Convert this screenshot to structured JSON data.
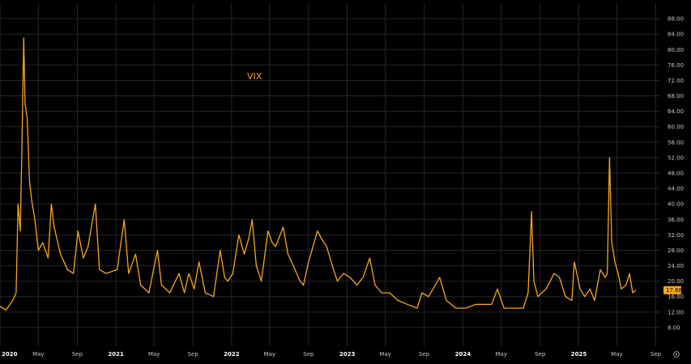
{
  "chart_data": {
    "type": "line",
    "series_label": "VIX",
    "last_value_label": "17.68",
    "settings_icon": "settings-gear-icon",
    "line_color": "#f5a623",
    "background_color": "#000000",
    "grid": true,
    "y_axis_position": "right",
    "ylim": [
      4,
      92
    ],
    "y_ticks": [
      "8.00",
      "12.00",
      "16.00",
      "20.00",
      "24.00",
      "28.00",
      "32.00",
      "36.00",
      "40.00",
      "44.00",
      "48.00",
      "52.00",
      "56.00",
      "60.00",
      "64.00",
      "68.00",
      "72.00",
      "76.00",
      "80.00",
      "84.00",
      "88.00"
    ],
    "xlim": [
      "2020-01-01",
      "2025-09-15"
    ],
    "x_ticks": [
      {
        "date": "2020-01-01",
        "label": "2020",
        "year": true
      },
      {
        "date": "2020-05-01",
        "label": "May"
      },
      {
        "date": "2020-09-01",
        "label": "Sep"
      },
      {
        "date": "2021-01-01",
        "label": "2021",
        "year": true
      },
      {
        "date": "2021-05-01",
        "label": "May"
      },
      {
        "date": "2021-09-01",
        "label": "Sep"
      },
      {
        "date": "2022-01-01",
        "label": "2022",
        "year": true
      },
      {
        "date": "2022-05-01",
        "label": "May"
      },
      {
        "date": "2022-09-01",
        "label": "Sep"
      },
      {
        "date": "2023-01-01",
        "label": "2023",
        "year": true
      },
      {
        "date": "2023-05-01",
        "label": "May"
      },
      {
        "date": "2023-09-01",
        "label": "Sep"
      },
      {
        "date": "2024-01-01",
        "label": "2024",
        "year": true
      },
      {
        "date": "2024-05-01",
        "label": "May"
      },
      {
        "date": "2024-09-01",
        "label": "Sep"
      },
      {
        "date": "2025-01-01",
        "label": "2025",
        "year": true
      },
      {
        "date": "2025-05-01",
        "label": "May"
      },
      {
        "date": "2025-09-01",
        "label": "Sep"
      }
    ],
    "series": [
      {
        "x": [
          "2020-01-01",
          "2020-01-20",
          "2020-02-10",
          "2020-02-21",
          "2020-02-27",
          "2020-03-05",
          "2020-03-10",
          "2020-03-16",
          "2020-03-20",
          "2020-03-27",
          "2020-04-03",
          "2020-04-10",
          "2020-04-20",
          "2020-05-01",
          "2020-05-15",
          "2020-06-01",
          "2020-06-11",
          "2020-06-20",
          "2020-07-10",
          "2020-08-01",
          "2020-08-20",
          "2020-09-03",
          "2020-09-20",
          "2020-10-05",
          "2020-10-28",
          "2020-11-10",
          "2020-12-01",
          "2021-01-05",
          "2021-01-27",
          "2021-02-10",
          "2021-03-04",
          "2021-03-20",
          "2021-04-15",
          "2021-05-12",
          "2021-05-25",
          "2021-06-20",
          "2021-07-19",
          "2021-08-05",
          "2021-08-19",
          "2021-09-05",
          "2021-09-20",
          "2021-10-10",
          "2021-11-05",
          "2021-11-26",
          "2021-12-10",
          "2021-12-20",
          "2022-01-05",
          "2022-01-24",
          "2022-02-10",
          "2022-02-24",
          "2022-03-07",
          "2022-03-20",
          "2022-04-05",
          "2022-04-26",
          "2022-05-09",
          "2022-05-20",
          "2022-06-13",
          "2022-06-28",
          "2022-07-15",
          "2022-08-05",
          "2022-08-16",
          "2022-09-01",
          "2022-09-29",
          "2022-10-12",
          "2022-10-28",
          "2022-11-15",
          "2022-12-01",
          "2022-12-20",
          "2023-01-10",
          "2023-02-01",
          "2023-02-20",
          "2023-03-13",
          "2023-03-30",
          "2023-04-20",
          "2023-05-15",
          "2023-06-10",
          "2023-07-10",
          "2023-08-10",
          "2023-08-25",
          "2023-09-15",
          "2023-10-20",
          "2023-11-10",
          "2023-12-10",
          "2024-01-10",
          "2024-02-10",
          "2024-03-10",
          "2024-04-01",
          "2024-04-19",
          "2024-05-10",
          "2024-06-10",
          "2024-07-10",
          "2024-07-25",
          "2024-08-05",
          "2024-08-12",
          "2024-08-25",
          "2024-09-06",
          "2024-09-20",
          "2024-10-15",
          "2024-11-01",
          "2024-11-20",
          "2024-12-10",
          "2024-12-18",
          "2025-01-05",
          "2025-01-20",
          "2025-02-05",
          "2025-02-20",
          "2025-03-10",
          "2025-03-25",
          "2025-04-01",
          "2025-04-08",
          "2025-04-15",
          "2025-04-25",
          "2025-05-05",
          "2025-05-15",
          "2025-05-30",
          "2025-06-10",
          "2025-06-20",
          "2025-06-30"
        ],
        "values": [
          13.5,
          12.5,
          15,
          17,
          40,
          33,
          54,
          83,
          66,
          62,
          46,
          41,
          36,
          28,
          30,
          26,
          40,
          34,
          27,
          23,
          22,
          33,
          26,
          29,
          40,
          23,
          22,
          23,
          36,
          22,
          27,
          19,
          17,
          28,
          19,
          17,
          22,
          17,
          22,
          18,
          25,
          17,
          16,
          28,
          21,
          20,
          22,
          32,
          27,
          31,
          36,
          24,
          20,
          33,
          30,
          29,
          34,
          27,
          24,
          20,
          19,
          25,
          33,
          31,
          29,
          24,
          20,
          22,
          21,
          19,
          21,
          26,
          19,
          17,
          17,
          15,
          14,
          13,
          17,
          16,
          21,
          15,
          13,
          13,
          14,
          14,
          14,
          18,
          13,
          13,
          13,
          17,
          38,
          20,
          16,
          17,
          18,
          22,
          21,
          16,
          15,
          25,
          18,
          16,
          18,
          15,
          23,
          21,
          22,
          52,
          30,
          25,
          22,
          18,
          19,
          22,
          17,
          17.68
        ]
      }
    ]
  }
}
